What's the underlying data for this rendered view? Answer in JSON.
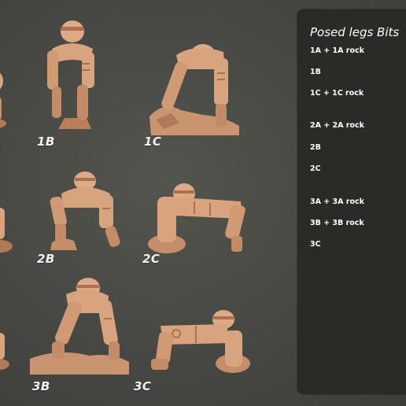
{
  "panel": {
    "title": "Posed legs Bits",
    "items": [
      "1A + 1A rock",
      "1B",
      "1C + 1C rock",
      "2A + 2A rock",
      "2B",
      "2C",
      "3A + 3A rock",
      "3B + 3B rock",
      "3C"
    ]
  },
  "figures": {
    "labels": [
      "1B",
      "1C",
      "2B",
      "2C",
      "3B",
      "3C"
    ]
  },
  "colors": {
    "background": "#4a4a47",
    "panel": "#2b2a27",
    "resin": "#d7a47f",
    "resin_shadow": "#a9714f",
    "label_text": "#f2f2f2"
  }
}
